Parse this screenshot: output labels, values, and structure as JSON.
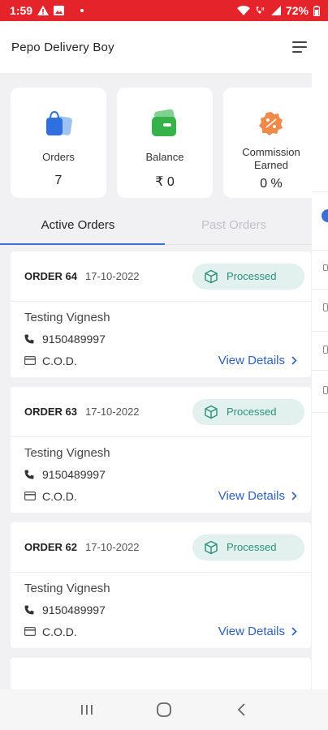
{
  "status_bar": {
    "time": "1:59",
    "battery": "72%"
  },
  "app": {
    "title": "Pepo Delivery Boy"
  },
  "stats": [
    {
      "label": "Orders",
      "value": "7",
      "icon": "shopping-bag-icon"
    },
    {
      "label": "Balance",
      "value": "₹ 0",
      "icon": "wallet-icon"
    },
    {
      "label_line1": "Commission",
      "label_line2": "Earned",
      "value": "0 %",
      "icon": "commission-badge-icon"
    }
  ],
  "tabs": {
    "active": "Active Orders",
    "inactive": "Past Orders"
  },
  "orders": [
    {
      "number": "ORDER 64",
      "date": "17-10-2022",
      "status": "Processed",
      "customer": "Testing Vignesh",
      "phone": "9150489997",
      "payment": "C.O.D.",
      "link": "View Details"
    },
    {
      "number": "ORDER 63",
      "date": "17-10-2022",
      "status": "Processed",
      "customer": "Testing Vignesh",
      "phone": "9150489997",
      "payment": "C.O.D.",
      "link": "View Details"
    },
    {
      "number": "ORDER 62",
      "date": "17-10-2022",
      "status": "Processed",
      "customer": "Testing Vignesh",
      "phone": "9150489997",
      "payment": "C.O.D.",
      "link": "View Details"
    }
  ],
  "colors": {
    "status_bar": "#e5232a",
    "accent": "#3a6fd8",
    "link": "#2e5fbf",
    "processed": "#2a8f7a"
  }
}
